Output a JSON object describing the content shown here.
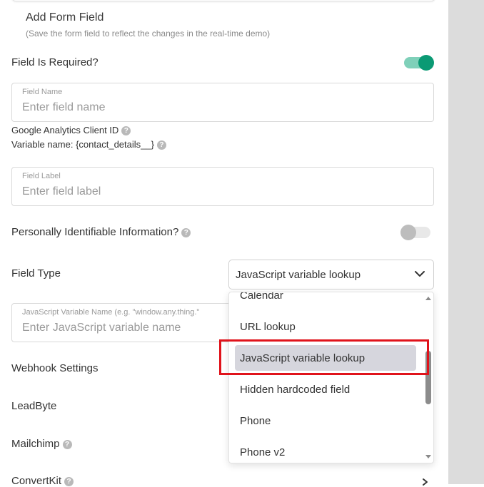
{
  "header": {
    "title": "Add Form Field",
    "subtitle": "(Save the form field to reflect the changes in the real-time demo)"
  },
  "required": {
    "label": "Field Is Required?",
    "on": true
  },
  "field_name": {
    "label": "Field Name",
    "placeholder": "Enter field name"
  },
  "info": {
    "ga_client_id": "Google Analytics Client ID",
    "variable_name": "Variable name: {contact_details__}"
  },
  "field_label": {
    "label": "Field Label",
    "placeholder": "Enter field label"
  },
  "pii": {
    "label": "Personally Identifiable Information?",
    "on": false
  },
  "field_type": {
    "label": "Field Type",
    "selected": "JavaScript variable lookup",
    "options": [
      "Calendar",
      "URL lookup",
      "JavaScript variable lookup",
      "Hidden hardcoded field",
      "Phone",
      "Phone v2"
    ]
  },
  "js_var": {
    "label": "JavaScript Variable Name (e.g. \"window.any.thing.\"",
    "placeholder": "Enter JavaScript variable name"
  },
  "sections": {
    "webhook": "Webhook Settings",
    "leadbyte": "LeadByte",
    "mailchimp": "Mailchimp",
    "convertkit": "ConvertKit"
  },
  "colors": {
    "toggle_on": "#0b9a74",
    "highlight_border": "#e0131b",
    "selected_bg": "#d6d6dd"
  }
}
